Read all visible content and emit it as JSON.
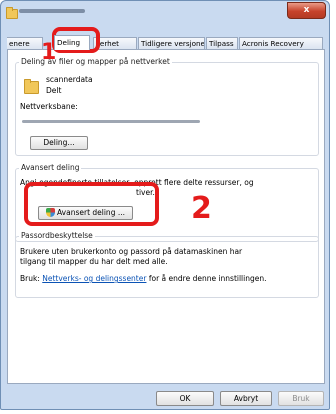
{
  "window": {
    "close_glyph": "x"
  },
  "tabs": [
    "enere",
    "Deling",
    "kerhet",
    "Tidligere versjoner",
    "Tilpass",
    "Acronis Recovery"
  ],
  "sharing": {
    "group_title": "Deling av filer og mapper på nettverket",
    "folder_name": "scannerdata",
    "status": "Delt",
    "path_label": "Nettverksbane:",
    "share_button": "Deling..."
  },
  "advanced": {
    "group_title": "Avansert deling",
    "description_line1": "Angi egendefinerte tillatelser, opprett flere delte ressurser, og",
    "description_line2": "tiver.",
    "button": "Avansert deling ..."
  },
  "password": {
    "group_title": "Passordbeskyttelse",
    "text_line1": "Brukere uten brukerkonto og passord på datamaskinen har",
    "text_line2": "tilgang til mapper du har delt med alle.",
    "use_prefix": "Bruk:",
    "link": "Nettverks- og delingssenter",
    "use_suffix": "for å endre denne innstillingen."
  },
  "footer": {
    "ok": "OK",
    "cancel": "Avbryt",
    "apply": "Bruk"
  },
  "annotations": {
    "step1": "1",
    "step2": "2",
    "color": "#e41b1b"
  },
  "colors": {
    "link": "#0b53b5",
    "window_frame": "#c9daf0"
  }
}
